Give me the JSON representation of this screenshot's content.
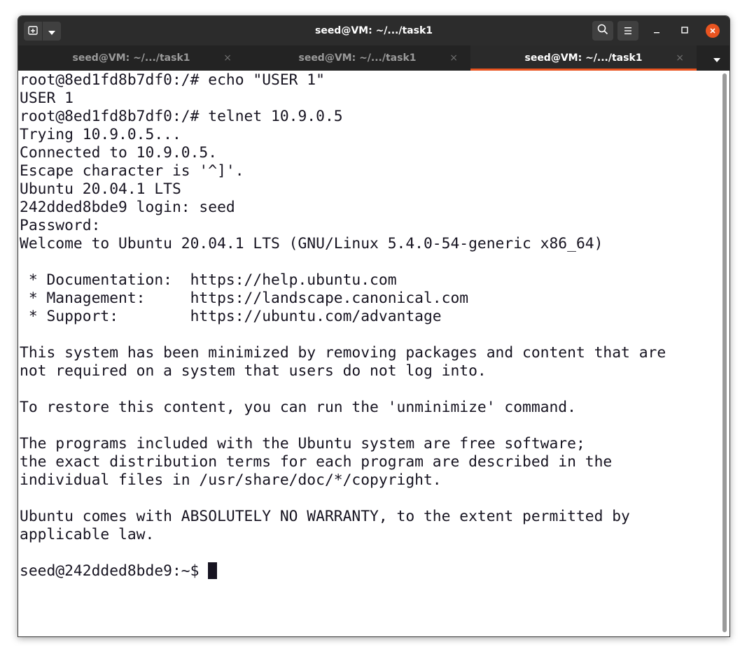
{
  "window": {
    "title": "seed@VM: ~/.../task1"
  },
  "tabs": [
    {
      "label": "seed@VM: ~/.../task1",
      "close": "×",
      "active": false
    },
    {
      "label": "seed@VM: ~/.../task1",
      "close": "×",
      "active": false
    },
    {
      "label": "seed@VM: ~/.../task1",
      "close": "×",
      "active": true
    }
  ],
  "titlebar_buttons": {
    "new_tab_icon": "new-tab-icon",
    "dropdown_icon": "chevron-down-icon",
    "search_icon": "search-icon",
    "menu_icon": "hamburger-icon",
    "minimize_icon": "minimize-icon",
    "maximize_icon": "maximize-icon",
    "close_icon": "close-icon"
  },
  "colors": {
    "accent": "#e95420",
    "titlebar": "#2c2c2c",
    "tabbar": "#232323",
    "terminal_bg": "#ffffff",
    "terminal_fg": "#171421"
  },
  "terminal": {
    "lines": [
      "root@8ed1fd8b7df0:/# echo \"USER 1\"",
      "USER 1",
      "root@8ed1fd8b7df0:/# telnet 10.9.0.5",
      "Trying 10.9.0.5...",
      "Connected to 10.9.0.5.",
      "Escape character is '^]'.",
      "Ubuntu 20.04.1 LTS",
      "242dded8bde9 login: seed",
      "Password: ",
      "Welcome to Ubuntu 20.04.1 LTS (GNU/Linux 5.4.0-54-generic x86_64)",
      "",
      " * Documentation:  https://help.ubuntu.com",
      " * Management:     https://landscape.canonical.com",
      " * Support:        https://ubuntu.com/advantage",
      "",
      "This system has been minimized by removing packages and content that are",
      "not required on a system that users do not log into.",
      "",
      "To restore this content, you can run the 'unminimize' command.",
      "",
      "The programs included with the Ubuntu system are free software;",
      "the exact distribution terms for each program are described in the",
      "individual files in /usr/share/doc/*/copyright.",
      "",
      "Ubuntu comes with ABSOLUTELY NO WARRANTY, to the extent permitted by",
      "applicable law.",
      ""
    ],
    "prompt": "seed@242dded8bde9:~$ "
  }
}
